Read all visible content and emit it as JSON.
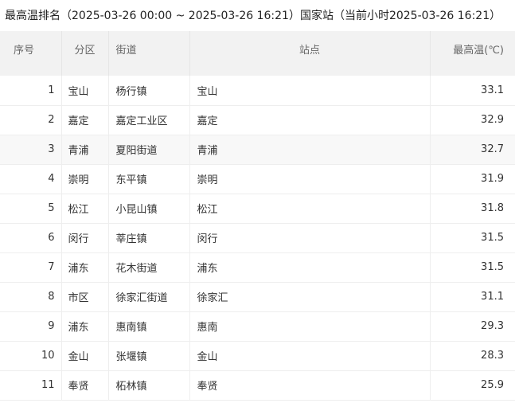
{
  "title": "最高温排名（2025-03-26 00:00 ~ 2025-03-26 16:21）国家站（当前小时2025-03-26 16:21）",
  "table": {
    "headers": {
      "index": "序号",
      "district": "分区",
      "street": "街道",
      "station": "站点",
      "max_temp": "最高温(℃)"
    },
    "rows": [
      {
        "index": "1",
        "district": "宝山",
        "street": "杨行镇",
        "station": "宝山",
        "max_temp": "33.1"
      },
      {
        "index": "2",
        "district": "嘉定",
        "street": "嘉定工业区",
        "station": "嘉定",
        "max_temp": "32.9"
      },
      {
        "index": "3",
        "district": "青浦",
        "street": "夏阳街道",
        "station": "青浦",
        "max_temp": "32.7"
      },
      {
        "index": "4",
        "district": "崇明",
        "street": "东平镇",
        "station": "崇明",
        "max_temp": "31.9"
      },
      {
        "index": "5",
        "district": "松江",
        "street": "小昆山镇",
        "station": "松江",
        "max_temp": "31.8"
      },
      {
        "index": "6",
        "district": "闵行",
        "street": "莘庄镇",
        "station": "闵行",
        "max_temp": "31.5"
      },
      {
        "index": "7",
        "district": "浦东",
        "street": "花木街道",
        "station": "浦东",
        "max_temp": "31.5"
      },
      {
        "index": "8",
        "district": "市区",
        "street": "徐家汇街道",
        "station": "徐家汇",
        "max_temp": "31.1"
      },
      {
        "index": "9",
        "district": "浦东",
        "street": "惠南镇",
        "station": "惠南",
        "max_temp": "29.3"
      },
      {
        "index": "10",
        "district": "金山",
        "street": "张堰镇",
        "station": "金山",
        "max_temp": "28.3"
      },
      {
        "index": "11",
        "district": "奉贤",
        "street": "柘林镇",
        "station": "奉贤",
        "max_temp": "25.9"
      }
    ],
    "highlighted_row": 2
  }
}
